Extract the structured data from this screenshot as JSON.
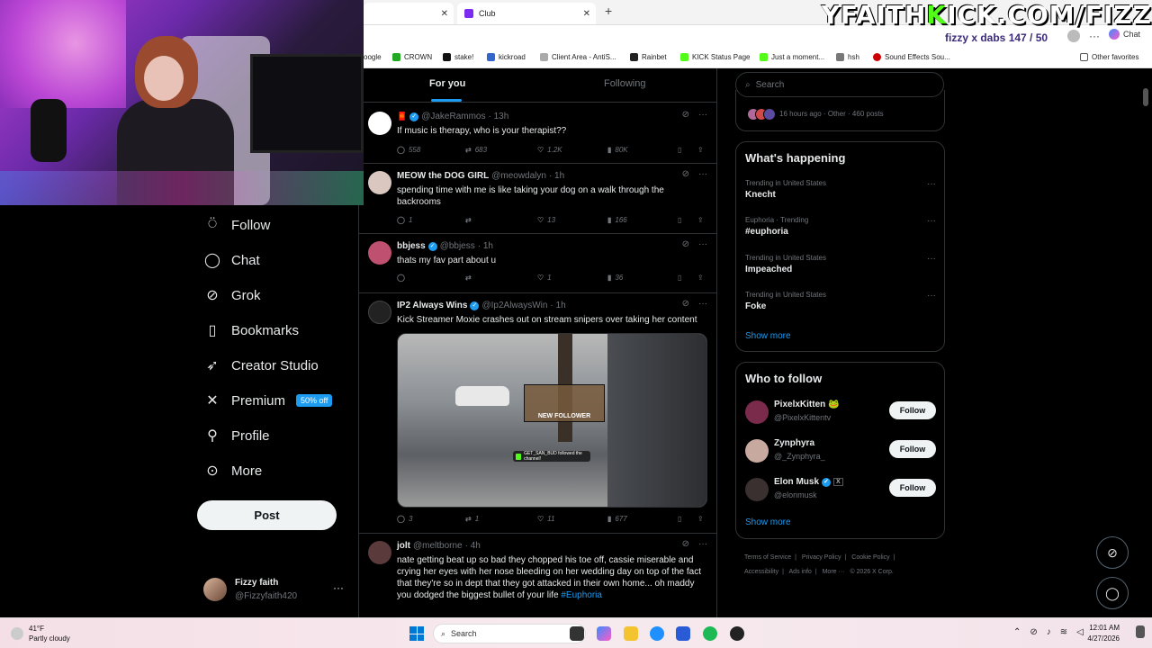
{
  "stream_overlay": {
    "site_prefix": "YFAITH",
    "site_k": "K",
    "site_suffix": "ICK.COM/FIZZ",
    "goal": "fizzy x dabs 147 / 50"
  },
  "browser": {
    "tabs": [
      {
        "label": ""
      },
      {
        "label": "Club"
      }
    ],
    "chat_label": "Chat",
    "bookmarks": [
      "oogle",
      "CROWN",
      "stake!",
      "kickroad",
      "Client Area - AntiS...",
      "Rainbet",
      "KICK Status Page",
      "Just a moment...",
      "hsh",
      "Sound Effects Sou..."
    ],
    "other_bookmarks": "Other favorites"
  },
  "nav": {
    "items": [
      {
        "label": "Follow",
        "icon": "person-plus-icon"
      },
      {
        "label": "Chat",
        "icon": "chat-bubble-icon"
      },
      {
        "label": "Grok",
        "icon": "grok-icon"
      },
      {
        "label": "Bookmarks",
        "icon": "bookmark-icon"
      },
      {
        "label": "Creator Studio",
        "icon": "rocket-icon"
      },
      {
        "label": "Premium",
        "icon": "x-logo-icon",
        "badge": "50% off"
      },
      {
        "label": "Profile",
        "icon": "person-icon"
      },
      {
        "label": "More",
        "icon": "more-circle-icon"
      }
    ],
    "post_label": "Post",
    "account": {
      "name": "Fizzy faith",
      "handle": "@Fizzyfaith420"
    }
  },
  "timeline": {
    "tabs": {
      "for_you": "For you",
      "following": "Following"
    },
    "tweets": [
      {
        "name": "",
        "handle": "@JakeRammos",
        "time": "· 13h",
        "text": "If music is therapy, who is your therapist??",
        "replies": "558",
        "reposts": "683",
        "likes": "1.2K",
        "views": "80K",
        "verified": true
      },
      {
        "name": "MEOW the DOG GIRL",
        "handle": "@meowdalyn",
        "time": "· 1h",
        "text": "spending time with me is like taking your dog on a walk through the backrooms",
        "replies": "1",
        "reposts": "",
        "likes": "13",
        "views": "166",
        "verified": false
      },
      {
        "name": "bbjess",
        "handle": "@bbjess",
        "time": "· 1h",
        "text": "thats my fav part about u",
        "replies": "",
        "reposts": "",
        "likes": "1",
        "views": "36",
        "verified": true
      },
      {
        "name": "IP2 Always Wins",
        "handle": "@Ip2AlwaysWin",
        "time": "· 1h",
        "text": "Kick Streamer Moxie crashes out on stream snipers over taking her content",
        "replies": "3",
        "reposts": "1",
        "likes": "11",
        "views": "677",
        "verified": true,
        "media_caption": "NEW FOLLOWER",
        "media_toast": "GET_SAN_BUD followed the channel!"
      },
      {
        "name": "jolt",
        "handle": "@meltborne",
        "time": "· 4h",
        "text": "nate getting beat up so bad they chopped his toe off, cassie miserable and crying her eyes with her nose bleeding on her wedding day on top of the fact that they're so in dept that they got attacked in their own home... oh maddy you dodged the biggest bullet of your life ",
        "hashtag": "#Euphoria",
        "verified": false
      }
    ]
  },
  "sidebar": {
    "search_placeholder": "Search",
    "community": {
      "meta": "16 hours ago · Other · 460 posts"
    },
    "happening": {
      "title": "What's happening",
      "trends": [
        {
          "context": "Trending in United States",
          "name": "Knecht"
        },
        {
          "context": "Euphoria · Trending",
          "name": "#euphoria"
        },
        {
          "context": "Trending in United States",
          "name": "Impeached"
        },
        {
          "context": "Trending in United States",
          "name": "Foke"
        }
      ],
      "show_more": "Show more"
    },
    "who_to_follow": {
      "title": "Who to follow",
      "users": [
        {
          "name": "PixelxKitten 🐸",
          "handle": "@PixelxKittentv",
          "button": "Follow",
          "verified": false
        },
        {
          "name": "Zynphyra",
          "handle": "@_Zynphyra_",
          "button": "Follow",
          "verified": false
        },
        {
          "name": "Elon Musk",
          "handle": "@elonmusk",
          "button": "Follow",
          "verified": true
        }
      ],
      "show_more": "Show more"
    },
    "footer": [
      "Terms of Service",
      "|",
      "Privacy Policy",
      "|",
      "Cookie Policy",
      "|",
      "Accessibility",
      "|",
      "Ads info",
      "|",
      "More ···",
      "© 2026 X Corp."
    ]
  },
  "taskbar": {
    "weather_temp": "41°F",
    "weather_desc": "Partly cloudy",
    "search_label": "Search",
    "time": "12:01 AM",
    "date": "4/27/2026"
  },
  "colors": {
    "accent": "#1d9bf0",
    "kick_green": "#53fc18",
    "bg": "#000000",
    "border": "#2f3336"
  }
}
